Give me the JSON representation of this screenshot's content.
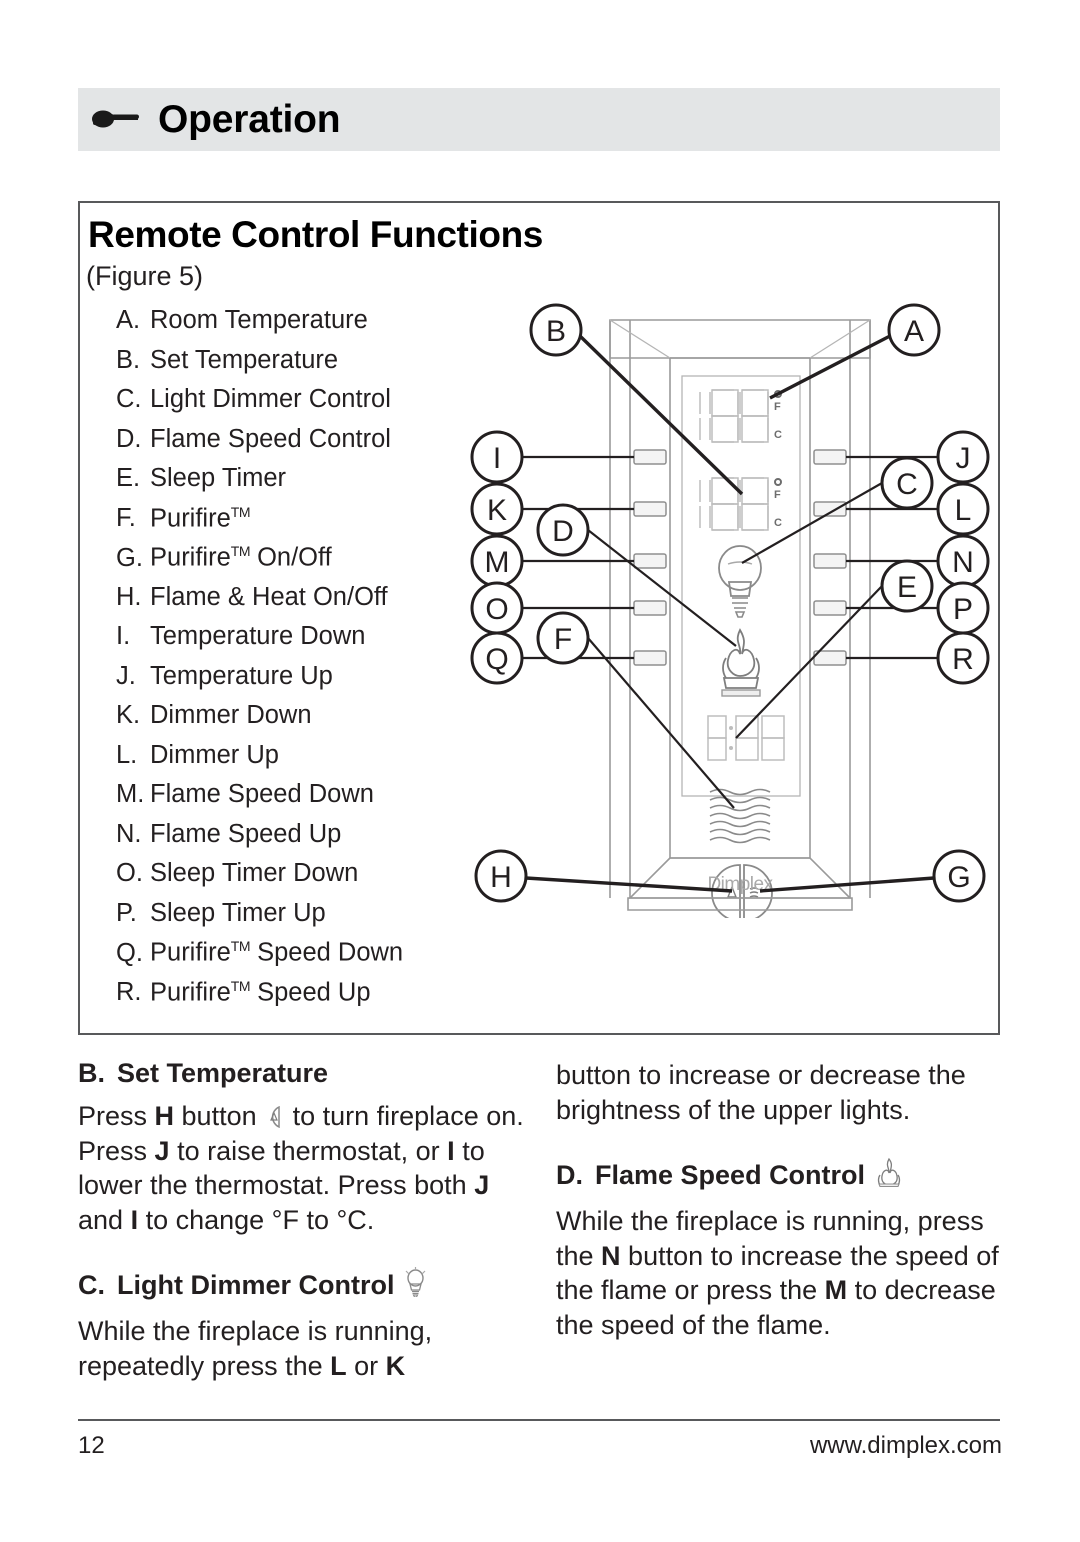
{
  "header": {
    "title": "Operation",
    "hand_icon": "pointing-hand-icon"
  },
  "figure": {
    "title": "Remote Control Functions",
    "subtitle": "(Figure 5)",
    "legend": [
      {
        "letter": "A.",
        "label": "Room Temperature"
      },
      {
        "letter": "B.",
        "label": "Set Temperature"
      },
      {
        "letter": "C.",
        "label": "Light Dimmer Control"
      },
      {
        "letter": "D.",
        "label": "Flame Speed Control"
      },
      {
        "letter": "E.",
        "label": "Sleep Timer"
      },
      {
        "letter": "F.",
        "label": "Purifire",
        "tm": "TM"
      },
      {
        "letter": "G.",
        "label": "Purifire",
        "tm": "TM",
        "label2": " On/Off"
      },
      {
        "letter": "H.",
        "label": "Flame & Heat On/Off"
      },
      {
        "letter": "I.",
        "label": "Temperature Down"
      },
      {
        "letter": "J.",
        "label": "Temperature Up"
      },
      {
        "letter": "K.",
        "label": "Dimmer Down"
      },
      {
        "letter": "L.",
        "label": "Dimmer Up"
      },
      {
        "letter": "M.",
        "label": "Flame Speed Down"
      },
      {
        "letter": "N.",
        "label": "Flame Speed Up"
      },
      {
        "letter": "O.",
        "label": "Sleep Timer Down"
      },
      {
        "letter": "P.",
        "label": "Sleep Timer Up"
      },
      {
        "letter": "Q.",
        "label": "Purifire",
        "tm": "TM",
        "label2": " Speed Down"
      },
      {
        "letter": "R.",
        "label": "Purifire",
        "tm": "TM",
        "label2": " Speed Up"
      }
    ],
    "diagram": {
      "brand": "Dimplex",
      "display_upper": {
        "unit_f": "F",
        "unit_c": "C"
      },
      "display_lower": {
        "unit_f": "F",
        "unit_c": "C"
      },
      "timer_readout": "8:88",
      "callouts_left": [
        "I",
        "K",
        "M",
        "O",
        "Q"
      ],
      "callouts_left_inset": [
        "D",
        "F"
      ],
      "callouts_right": [
        "J",
        "L",
        "N",
        "P",
        "R"
      ],
      "callouts_right_inset": [
        "C",
        "E"
      ],
      "callout_top_left": "B",
      "callout_top_right": "A",
      "callout_bottom_left": "H",
      "callout_bottom_right": "G"
    }
  },
  "sections": {
    "b": {
      "letter": "B.",
      "title": "Set Temperature",
      "line1_a": "Press ",
      "line1_b": "H",
      "line1_c": " button ",
      "line1_d": " to turn fireplace on. Press ",
      "line1_e": "J",
      "line1_f": " to raise thermostat, or ",
      "line1_g": "I",
      "line1_h": " to lower the thermostat. Press both ",
      "line1_i": "J",
      "line1_j": " and ",
      "line1_k": "I",
      "line1_l": " to change °F to °C."
    },
    "c": {
      "letter": "C.",
      "title": "Light Dimmer Control",
      "icon": "light-bulb-icon",
      "text_a": "While the fireplace is running, repeatedly press the ",
      "text_b": "L",
      "text_c": " or ",
      "text_d": "K",
      "text_e": " button to increase or decrease the brightness of the upper lights."
    },
    "d": {
      "letter": "D.",
      "title": "Flame Speed Control",
      "icon": "flame-icon",
      "text_a": "While the fireplace is running, press the ",
      "text_b": "N",
      "text_c": " button to increase the speed of the flame or press the ",
      "text_d": "M",
      "text_e": " to decrease the speed of the flame."
    }
  },
  "footer": {
    "page_number": "12",
    "website": "www.dimplex.com"
  },
  "colors": {
    "header_band": "#e3e5e6",
    "border": "#58595b",
    "text": "#231f20"
  }
}
